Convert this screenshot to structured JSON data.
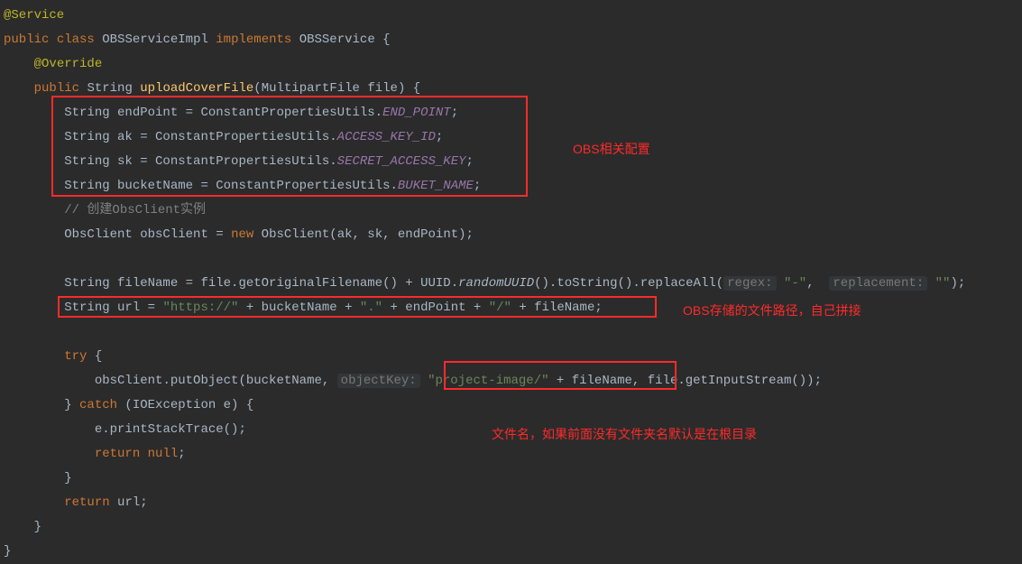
{
  "code": {
    "ann_service": "@Service",
    "kw_public": "public",
    "kw_class": "class",
    "cls_name": "OBSServiceImpl",
    "kw_implements": "implements",
    "iface_name": "OBSService",
    "ann_override": "@Override",
    "ret_type": "String",
    "method_name": "uploadCoverFile",
    "param_type": "MultipartFile",
    "param_name": "file",
    "l_endpoint_decl": "String endPoint = ConstantPropertiesUtils.",
    "sf_endpoint": "END_POINT",
    "l_ak_decl": "String ak = ConstantPropertiesUtils.",
    "sf_ak": "ACCESS_KEY_ID",
    "l_sk_decl": "String sk = ConstantPropertiesUtils.",
    "sf_sk": "SECRET_ACCESS_KEY",
    "l_bucket_decl": "String bucketName = ConstantPropertiesUtils.",
    "sf_bucket": "BUKET_NAME",
    "comment_create": "// 创建ObsClient实例",
    "l_client_left": "ObsClient obsClient = ",
    "kw_new": "new",
    "l_client_ctor": " ObsClient(ak, sk, endPoint);",
    "l_filename_left": "String fileName = file.getOriginalFilename() + UUID.",
    "sm_randomuuid": "randomUUID",
    "l_filename_mid": "().toString().replaceAll(",
    "hint_regex": "regex:",
    "str_regex": " \"-\"",
    "comma1": ",  ",
    "hint_replacement": "replacement:",
    "str_replacement": " \"\"",
    "l_filename_end": ");",
    "l_url_left": "String url = ",
    "str_https": "\"https://\"",
    "plus1": " + bucketName + ",
    "str_dot": "\".\"",
    "plus2": " + endPoint + ",
    "str_slash": "\"/\"",
    "plus3": " + fileName;",
    "kw_try": "try",
    "l_put_left": "obsClient.putObject(bucketName, ",
    "hint_objkey": "objectKey:",
    "str_project": " \"project-image/\"",
    "l_put_mid": " + fileName,",
    "l_put_right": " file.getInputStream());",
    "kw_catch": "catch",
    "catch_param": " (IOException e) {",
    "l_print": "e.printStackTrace();",
    "kw_return": "return",
    "kw_null": "null",
    "l_return_url": " url;"
  },
  "annotations": {
    "label_config": "OBS相关配置",
    "label_url": "OBS存储的文件路径，自己拼接",
    "label_filename": "文件名，如果前面没有文件夹名默认是在根目录"
  }
}
